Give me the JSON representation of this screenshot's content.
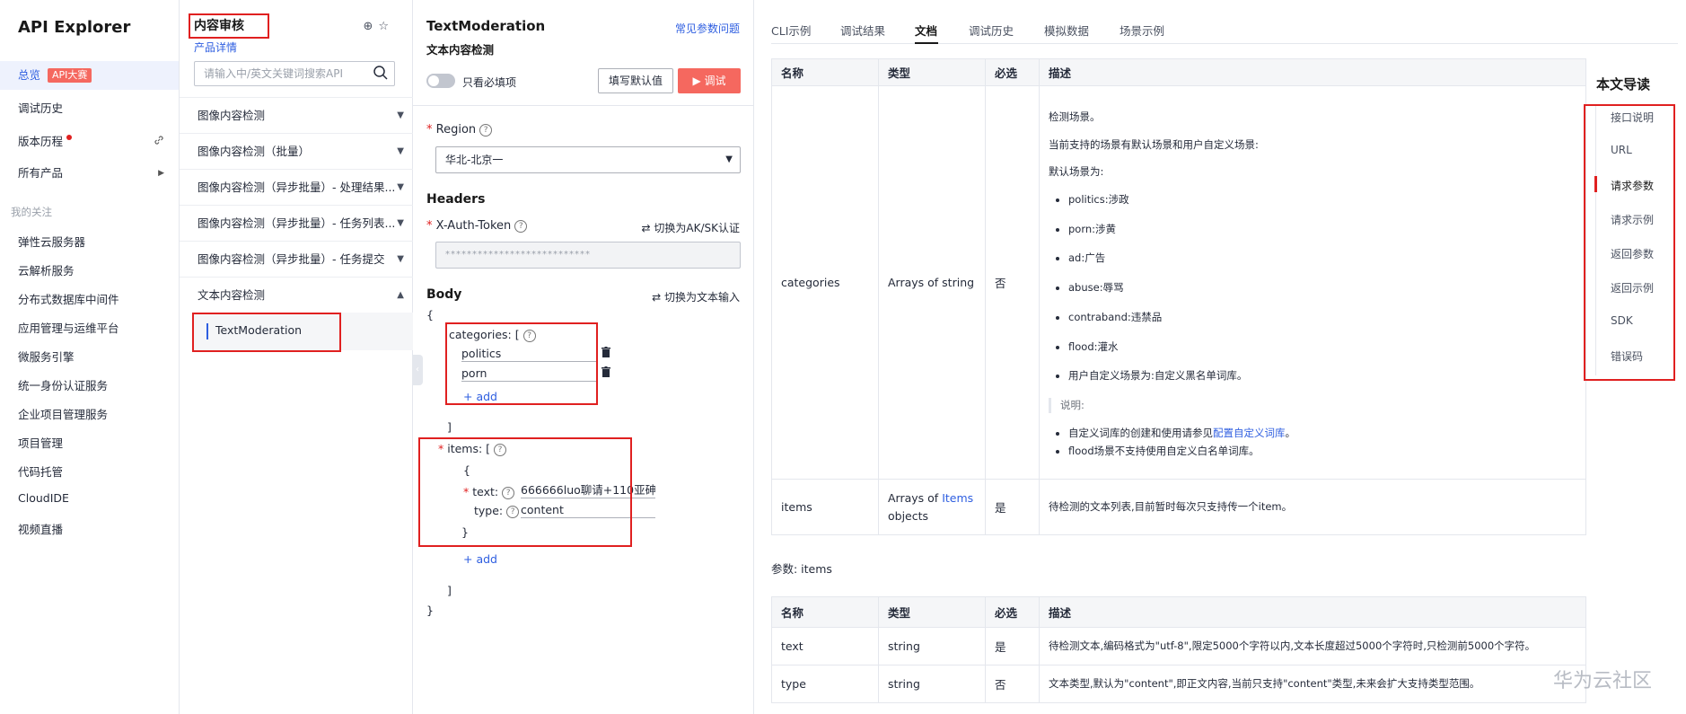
{
  "app": {
    "title": "API Explorer"
  },
  "left_nav": {
    "items": [
      {
        "label": "总览",
        "badge": "API大赛"
      },
      {
        "label": "调试历史"
      },
      {
        "label": "版本历程"
      },
      {
        "label": "所有产品"
      }
    ],
    "section_label": "我的关注",
    "favorites": [
      "弹性云服务器",
      "云解析服务",
      "分布式数据库中间件",
      "应用管理与运维平台",
      "微服务引擎",
      "统一身份认证服务",
      "企业项目管理服务",
      "项目管理",
      "代码托管",
      "CloudIDE",
      "视频直播"
    ]
  },
  "service": {
    "title": "内容审核",
    "detail_link": "产品详情",
    "search_placeholder": "请输入中/英文关键词搜索API",
    "groups": [
      "图像内容检测",
      "图像内容检测（批量）",
      "图像内容检测（异步批量）- 处理结果...",
      "图像内容检测（异步批量）- 任务列表...",
      "图像内容检测（异步批量）- 任务提交",
      "文本内容检测"
    ],
    "selected_api": "TextModeration"
  },
  "debug": {
    "api_name": "TextModeration",
    "api_desc": "文本内容检测",
    "faq_link": "常见参数问题",
    "required_only_label": "只看必填项",
    "fill_default_btn": "填写默认值",
    "debug_btn": "调试",
    "region_label": "Region",
    "region_value": "华北-北京一",
    "headers_title": "Headers",
    "token_label": "X-Auth-Token",
    "token_value": "***************************",
    "switch_aksk": "切换为AK/SK认证",
    "body_title": "Body",
    "switch_text": "切换为文本输入",
    "brace_open": "{",
    "brace_close": "}",
    "bracket_close": "]",
    "categories_key": "categories: [",
    "categories": [
      "politics",
      "porn"
    ],
    "add_label": "add",
    "items_key": "items: [",
    "text_key": "text:",
    "text_value": "666666luo聊请+110亚砷",
    "type_key": "type:",
    "type_value": "content"
  },
  "doc": {
    "tabs": [
      "CLI示例",
      "调试结果",
      "文档",
      "调试历史",
      "模拟数据",
      "场景示例"
    ],
    "active_tab": 2,
    "headers": [
      "名称",
      "类型",
      "必选",
      "描述"
    ],
    "categories_row": {
      "name": "categories",
      "type": "Arrays of string",
      "required": "否",
      "desc_1": "检测场景。",
      "desc_2": "当前支持的场景有默认场景和用户自定义场景:",
      "desc_3": "默认场景为:",
      "scenes": [
        "politics:涉政",
        "porn:涉黄",
        "ad:广告",
        "abuse:辱骂",
        "contraband:违禁品",
        "flood:灌水"
      ],
      "custom_scene": "用户自定义场景为:自定义黑名单词库。",
      "note_label": "说明:",
      "note_1_prefix": "自定义词库的创建和使用请参见",
      "note_1_link": "配置自定义词库",
      "note_1_suffix": "。",
      "note_2": "flood场景不支持使用自定义白名单词库。"
    },
    "items_row": {
      "name": "items",
      "type_prefix": "Arrays of ",
      "type_link": "Items",
      "type_suffix": "objects",
      "required": "是",
      "desc": "待检测的文本列表,目前暂时每次只支持传一个item。"
    },
    "params_label": "参数: items",
    "items_table": [
      {
        "name": "text",
        "type": "string",
        "required": "是",
        "desc": "待检测文本,编码格式为\"utf-8\",限定5000个字符以内,文本长度超过5000个字符时,只检测前5000个字符。"
      },
      {
        "name": "type",
        "type": "string",
        "required": "否",
        "desc": "文本类型,默认为\"content\",即正文内容,当前只支持\"content\"类型,未来会扩大支持类型范围。"
      }
    ]
  },
  "toc": {
    "title": "本文导读",
    "items": [
      "接口说明",
      "URL",
      "请求参数",
      "请求示例",
      "返回参数",
      "返回示例",
      "SDK",
      "错误码"
    ],
    "active": 2
  },
  "watermark": "华为云社区"
}
